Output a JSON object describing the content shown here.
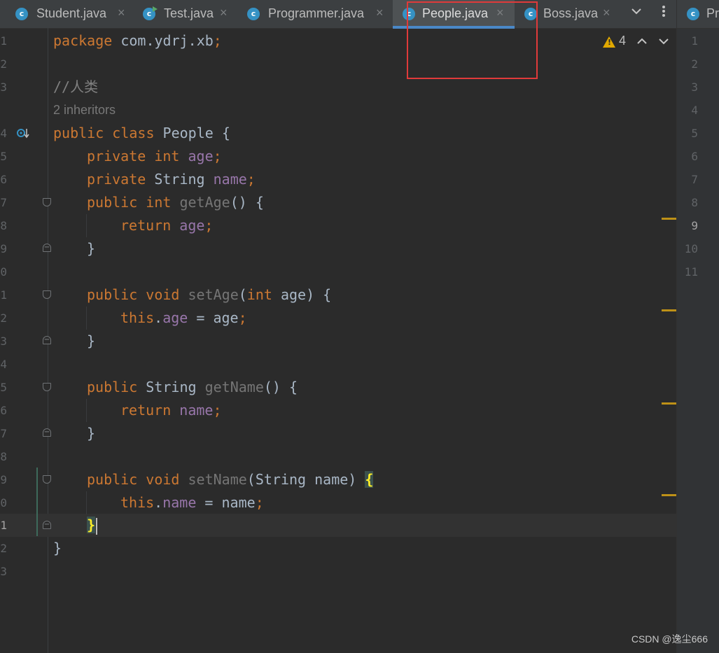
{
  "tabs": [
    {
      "label": "Student.java",
      "icon": "class-icon",
      "active": false
    },
    {
      "label": "Test.java",
      "icon": "runnable-class-icon",
      "active": false
    },
    {
      "label": "Programmer.java",
      "icon": "class-icon",
      "active": false
    },
    {
      "label": "People.java",
      "icon": "class-icon",
      "active": true
    },
    {
      "label": "Boss.java",
      "icon": "class-icon",
      "active": false
    }
  ],
  "tab_close_glyph": "×",
  "tab_icon_letter": "c",
  "tab_overflow_icon": "chevron-down-icon",
  "tab_more_icon": "more-vertical-icon",
  "right_pane_tab": {
    "label": "Pr",
    "icon": "class-icon"
  },
  "inspection": {
    "warning_count": "4",
    "warning_icon": "warning-icon",
    "prev_icon": "chevron-up-icon",
    "next_icon": "chevron-down-icon"
  },
  "editor": {
    "line_numbers": [
      "1",
      "2",
      "3",
      "",
      "4",
      "5",
      "6",
      "7",
      "8",
      "9",
      "0",
      "1",
      "2",
      "3",
      "4",
      "5",
      "6",
      "7",
      "8",
      "9",
      "0",
      "1",
      "2",
      "3"
    ],
    "current_line_number": "1",
    "inheritors_hint": "2 inheritors",
    "gutter_icon": "implemented-override-icon",
    "code": {
      "l1a": "package",
      "l1b": " com.ydrj.xb",
      "l1c": ";",
      "l3": "//人类",
      "l4a": "public class",
      "l4b": " People {",
      "l5a": "private int",
      "l5b": " age",
      "l5c": ";",
      "l6a": "private",
      "l6b": " String ",
      "l6c": "name",
      "l6d": ";",
      "l7a": "public int",
      "l7b": " getAge",
      "l7c": "() {",
      "l8a": "return",
      "l8b": " age",
      "l8c": ";",
      "close": "}",
      "l11a": "public void",
      "l11b": " setAge",
      "l11c": "(",
      "l11d": "int",
      "l11e": " age) {",
      "l12a": "this",
      "l12b": ".",
      "l12c": "age",
      "l12d": " = age",
      "l12e": ";",
      "l15a": "public",
      "l15b": " String ",
      "l15c": "getName",
      "l15d": "() {",
      "l16a": "return",
      "l16b": " name",
      "l16c": ";",
      "l19a": "public void",
      "l19b": " setName",
      "l19c": "(String name) ",
      "l19d": "{",
      "l20a": "this",
      "l20b": ".",
      "l20c": "name",
      "l20d": " = name",
      "l20e": ";",
      "l21": "}",
      "l22": "}"
    }
  },
  "right_pane_line_numbers": [
    "1",
    "2",
    "3",
    "4",
    "5",
    "6",
    "7",
    "8",
    "9",
    "10",
    "11"
  ],
  "right_pane_current_line": "9",
  "watermark": "CSDN @逸尘666",
  "colors": {
    "keyword": "#cc7832",
    "field": "#9876aa",
    "comment": "#808080",
    "text": "#a9b7c6",
    "accent": "#4a88c7",
    "warning": "#e0a800",
    "annotation": "#e03a3a"
  }
}
